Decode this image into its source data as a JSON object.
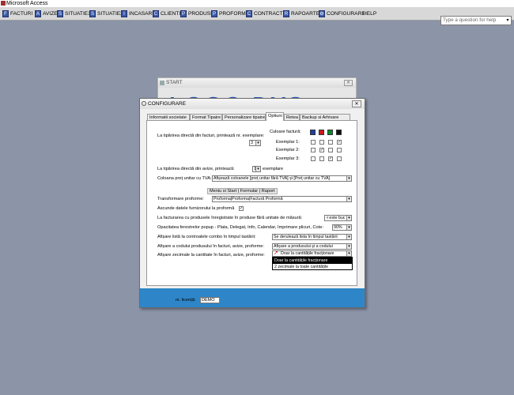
{
  "app": {
    "title": "Microsoft Access"
  },
  "menu": [
    {
      "label": "FACTURI",
      "icon": "invoice-icon"
    },
    {
      "label": "AVIZE",
      "icon": "notice-icon"
    },
    {
      "label": "SITUATIE1",
      "icon": "report-icon"
    },
    {
      "label": "SITUATIE2",
      "icon": "report-icon"
    },
    {
      "label": "INCASARI",
      "icon": "cash-icon"
    },
    {
      "label": "CLIENTI",
      "icon": "clients-icon"
    },
    {
      "label": "PRODUSE",
      "icon": "products-icon"
    },
    {
      "label": "PROFORME",
      "icon": "proforma-icon"
    },
    {
      "label": "CONTRACTE",
      "icon": "contract-icon"
    },
    {
      "label": "RAPOARTE",
      "icon": "reports-icon"
    },
    {
      "label": "CONFIGURARE",
      "icon": "gear-icon"
    },
    {
      "label": "HELP",
      "icon": ""
    }
  ],
  "help_placeholder": "Type a question for help",
  "start": {
    "title": "START",
    "logo": "LOGO DVS"
  },
  "config": {
    "title": "CONFIGURARE",
    "tabs": [
      "Informatii societate",
      "Format Tipaire",
      "Personalizare tipaire",
      "Optiuni",
      "Retea",
      "Backup si Arhivare"
    ],
    "active_tab": "Optiuni",
    "invoice_print_label": "La tipărirea directă din facturi, printează nr. exemplare:",
    "invoice_copies": "3",
    "color_label": "Culoare factură:",
    "swatch_colors": [
      "#1e3fa8",
      "#cc1818",
      "#0a8a2a",
      "#111111"
    ],
    "exemplars": [
      {
        "label": "Exemplar 1:",
        "checks": [
          false,
          false,
          false,
          true
        ]
      },
      {
        "label": "Exemplar 2:",
        "checks": [
          false,
          true,
          false,
          false
        ]
      },
      {
        "label": "Exemplar 3:",
        "checks": [
          false,
          false,
          true,
          false
        ]
      }
    ],
    "notice_print_label": "La tipărirea directă din avize, printează:",
    "notice_copies": "1",
    "notice_unit": "exemplare",
    "vat_label": "Coloana preț unitar cu TVA:",
    "vat_value": "Afișează coloanele [preț unitar fără TVA] și [Preț unitar cu TVA]",
    "menu_group": "Meniu si Start | Formular | Raport",
    "proforma_label": "Transformare proforme:",
    "proforma_value": "Proforma|Proforma|Factură Proformă",
    "hide_supplier_label": "Ascunde datele furnizorului la proformă",
    "invoice_products_label": "La facturarea cu produsele înregistrate în produse fără unitate de măsură:",
    "invoice_products_value": "-i este buc",
    "opacity_label": "Opacitatea ferestrelor popup - Plata, Delegat, Info, Calendar, Imprimare plicuri, Cote:",
    "opacity_value": "90%",
    "combo_list_label": "Afișare listă la controalele combo în timpul tastării:",
    "combo_list_value": "Se derulează lista în timpul tastării",
    "product_code_label": "Afișare a codului produsului în facturi, avize, proforme:",
    "product_code_value": "Afișare a produsului și a codului",
    "decimals_label": "Afișare zecimale la cantitate în facturi, avize, proforme:",
    "decimals_value": "Doar la cantitățile fracționare",
    "decimals_options": [
      "Doar la cantitățile fracționare",
      "2 zecimale la toate cantitățile"
    ],
    "license_label": "nr. licență:",
    "license_value": "DEMO"
  }
}
